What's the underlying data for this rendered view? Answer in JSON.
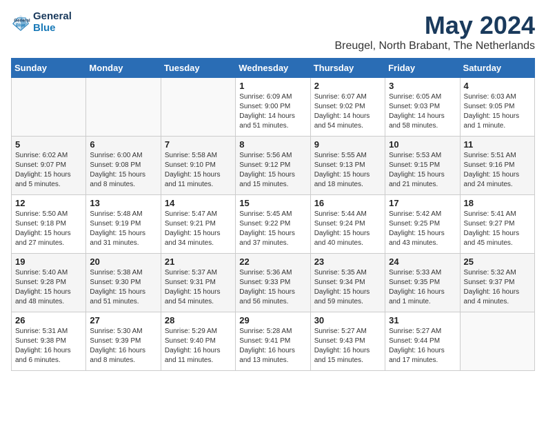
{
  "header": {
    "logo_line1": "General",
    "logo_line2": "Blue",
    "title": "May 2024",
    "subtitle": "Breugel, North Brabant, The Netherlands"
  },
  "days_of_week": [
    "Sunday",
    "Monday",
    "Tuesday",
    "Wednesday",
    "Thursday",
    "Friday",
    "Saturday"
  ],
  "weeks": [
    [
      {
        "num": "",
        "info": ""
      },
      {
        "num": "",
        "info": ""
      },
      {
        "num": "",
        "info": ""
      },
      {
        "num": "1",
        "info": "Sunrise: 6:09 AM\nSunset: 9:00 PM\nDaylight: 14 hours\nand 51 minutes."
      },
      {
        "num": "2",
        "info": "Sunrise: 6:07 AM\nSunset: 9:02 PM\nDaylight: 14 hours\nand 54 minutes."
      },
      {
        "num": "3",
        "info": "Sunrise: 6:05 AM\nSunset: 9:03 PM\nDaylight: 14 hours\nand 58 minutes."
      },
      {
        "num": "4",
        "info": "Sunrise: 6:03 AM\nSunset: 9:05 PM\nDaylight: 15 hours\nand 1 minute."
      }
    ],
    [
      {
        "num": "5",
        "info": "Sunrise: 6:02 AM\nSunset: 9:07 PM\nDaylight: 15 hours\nand 5 minutes."
      },
      {
        "num": "6",
        "info": "Sunrise: 6:00 AM\nSunset: 9:08 PM\nDaylight: 15 hours\nand 8 minutes."
      },
      {
        "num": "7",
        "info": "Sunrise: 5:58 AM\nSunset: 9:10 PM\nDaylight: 15 hours\nand 11 minutes."
      },
      {
        "num": "8",
        "info": "Sunrise: 5:56 AM\nSunset: 9:12 PM\nDaylight: 15 hours\nand 15 minutes."
      },
      {
        "num": "9",
        "info": "Sunrise: 5:55 AM\nSunset: 9:13 PM\nDaylight: 15 hours\nand 18 minutes."
      },
      {
        "num": "10",
        "info": "Sunrise: 5:53 AM\nSunset: 9:15 PM\nDaylight: 15 hours\nand 21 minutes."
      },
      {
        "num": "11",
        "info": "Sunrise: 5:51 AM\nSunset: 9:16 PM\nDaylight: 15 hours\nand 24 minutes."
      }
    ],
    [
      {
        "num": "12",
        "info": "Sunrise: 5:50 AM\nSunset: 9:18 PM\nDaylight: 15 hours\nand 27 minutes."
      },
      {
        "num": "13",
        "info": "Sunrise: 5:48 AM\nSunset: 9:19 PM\nDaylight: 15 hours\nand 31 minutes."
      },
      {
        "num": "14",
        "info": "Sunrise: 5:47 AM\nSunset: 9:21 PM\nDaylight: 15 hours\nand 34 minutes."
      },
      {
        "num": "15",
        "info": "Sunrise: 5:45 AM\nSunset: 9:22 PM\nDaylight: 15 hours\nand 37 minutes."
      },
      {
        "num": "16",
        "info": "Sunrise: 5:44 AM\nSunset: 9:24 PM\nDaylight: 15 hours\nand 40 minutes."
      },
      {
        "num": "17",
        "info": "Sunrise: 5:42 AM\nSunset: 9:25 PM\nDaylight: 15 hours\nand 43 minutes."
      },
      {
        "num": "18",
        "info": "Sunrise: 5:41 AM\nSunset: 9:27 PM\nDaylight: 15 hours\nand 45 minutes."
      }
    ],
    [
      {
        "num": "19",
        "info": "Sunrise: 5:40 AM\nSunset: 9:28 PM\nDaylight: 15 hours\nand 48 minutes."
      },
      {
        "num": "20",
        "info": "Sunrise: 5:38 AM\nSunset: 9:30 PM\nDaylight: 15 hours\nand 51 minutes."
      },
      {
        "num": "21",
        "info": "Sunrise: 5:37 AM\nSunset: 9:31 PM\nDaylight: 15 hours\nand 54 minutes."
      },
      {
        "num": "22",
        "info": "Sunrise: 5:36 AM\nSunset: 9:33 PM\nDaylight: 15 hours\nand 56 minutes."
      },
      {
        "num": "23",
        "info": "Sunrise: 5:35 AM\nSunset: 9:34 PM\nDaylight: 15 hours\nand 59 minutes."
      },
      {
        "num": "24",
        "info": "Sunrise: 5:33 AM\nSunset: 9:35 PM\nDaylight: 16 hours\nand 1 minute."
      },
      {
        "num": "25",
        "info": "Sunrise: 5:32 AM\nSunset: 9:37 PM\nDaylight: 16 hours\nand 4 minutes."
      }
    ],
    [
      {
        "num": "26",
        "info": "Sunrise: 5:31 AM\nSunset: 9:38 PM\nDaylight: 16 hours\nand 6 minutes."
      },
      {
        "num": "27",
        "info": "Sunrise: 5:30 AM\nSunset: 9:39 PM\nDaylight: 16 hours\nand 8 minutes."
      },
      {
        "num": "28",
        "info": "Sunrise: 5:29 AM\nSunset: 9:40 PM\nDaylight: 16 hours\nand 11 minutes."
      },
      {
        "num": "29",
        "info": "Sunrise: 5:28 AM\nSunset: 9:41 PM\nDaylight: 16 hours\nand 13 minutes."
      },
      {
        "num": "30",
        "info": "Sunrise: 5:27 AM\nSunset: 9:43 PM\nDaylight: 16 hours\nand 15 minutes."
      },
      {
        "num": "31",
        "info": "Sunrise: 5:27 AM\nSunset: 9:44 PM\nDaylight: 16 hours\nand 17 minutes."
      },
      {
        "num": "",
        "info": ""
      }
    ]
  ]
}
